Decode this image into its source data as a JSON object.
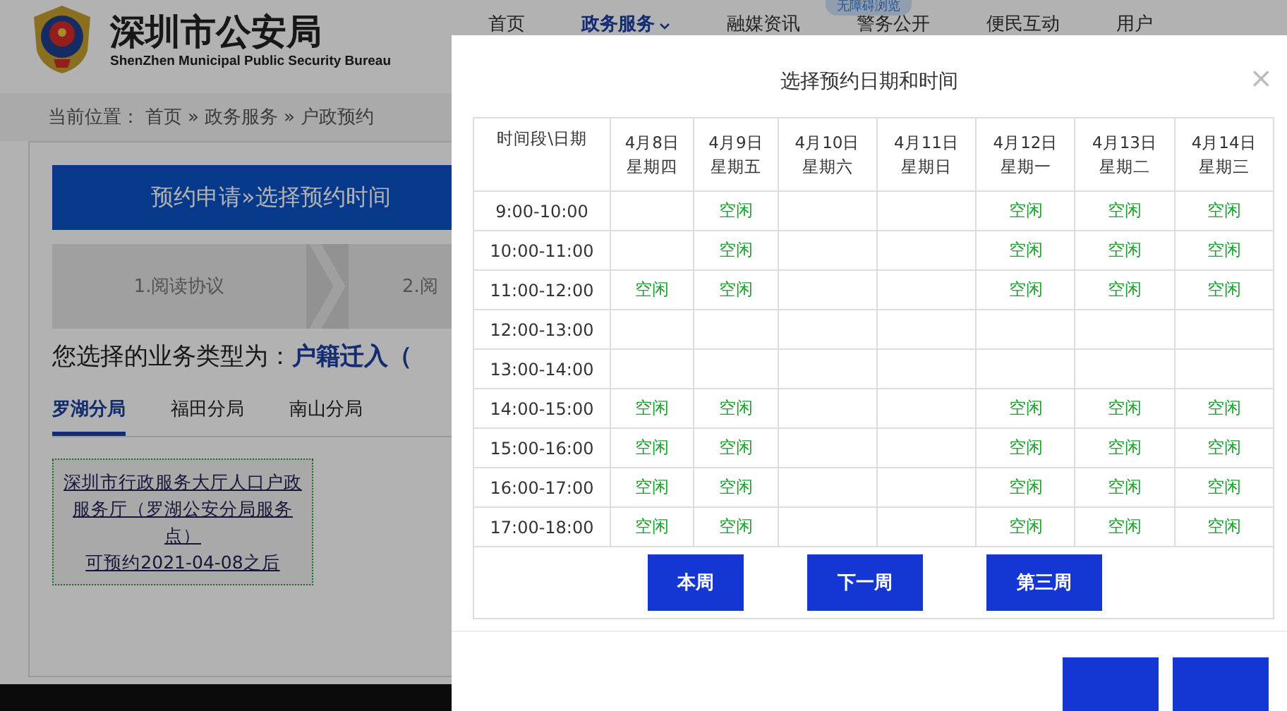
{
  "header": {
    "title": "深圳市公安局",
    "subtitle": "ShenZhen Municipal Public Security Bureau",
    "accessibility_badge": "无障碍浏览"
  },
  "nav": [
    {
      "label": "首页",
      "selected": false,
      "dropdown": false
    },
    {
      "label": "政务服务",
      "selected": true,
      "dropdown": true
    },
    {
      "label": "融媒资讯",
      "selected": false,
      "dropdown": false
    },
    {
      "label": "警务公开",
      "selected": false,
      "dropdown": false
    },
    {
      "label": "便民互动",
      "selected": false,
      "dropdown": false
    },
    {
      "label": "用户",
      "selected": false,
      "dropdown": false
    }
  ],
  "breadcrumb": {
    "label": "当前位置：",
    "separator": "»",
    "items": [
      "首页",
      "政务服务",
      "户政预约"
    ]
  },
  "banner": "预约申请»选择预约时间",
  "steps": [
    "1.阅读协议",
    "2.阅"
  ],
  "business": {
    "label": "您选择的业务类型为：",
    "value": "户籍迁入（"
  },
  "branch_tabs": [
    {
      "label": "罗湖分局",
      "selected": true
    },
    {
      "label": "福田分局",
      "selected": false
    },
    {
      "label": "南山分局",
      "selected": false
    }
  ],
  "service_points": [
    {
      "name": "深圳市行政服务大厅人口户政服务厅（罗湖公安分局服务点）",
      "availability": "可预约2021-04-08之后"
    }
  ],
  "modal": {
    "title": "选择预约日期和时间",
    "close": "×",
    "table": {
      "corner": "时间段\\日期",
      "columns": [
        {
          "date": "4月8日",
          "weekday": "星期四"
        },
        {
          "date": "4月9日",
          "weekday": "星期五"
        },
        {
          "date": "4月10日",
          "weekday": "星期六"
        },
        {
          "date": "4月11日",
          "weekday": "星期日"
        },
        {
          "date": "4月12日",
          "weekday": "星期一"
        },
        {
          "date": "4月13日",
          "weekday": "星期二"
        },
        {
          "date": "4月14日",
          "weekday": "星期三"
        }
      ],
      "rows": [
        {
          "time": "9:00-10:00",
          "cells": [
            null,
            "空闲",
            null,
            null,
            "空闲",
            "空闲",
            "空闲"
          ]
        },
        {
          "time": "10:00-11:00",
          "cells": [
            null,
            "空闲",
            null,
            null,
            "空闲",
            "空闲",
            "空闲"
          ]
        },
        {
          "time": "11:00-12:00",
          "cells": [
            "空闲",
            "空闲",
            null,
            null,
            "空闲",
            "空闲",
            "空闲"
          ]
        },
        {
          "time": "12:00-13:00",
          "cells": [
            null,
            null,
            null,
            null,
            null,
            null,
            null
          ]
        },
        {
          "time": "13:00-14:00",
          "cells": [
            null,
            null,
            null,
            null,
            null,
            null,
            null
          ]
        },
        {
          "time": "14:00-15:00",
          "cells": [
            "空闲",
            "空闲",
            null,
            null,
            "空闲",
            "空闲",
            "空闲"
          ]
        },
        {
          "time": "15:00-16:00",
          "cells": [
            "空闲",
            "空闲",
            null,
            null,
            "空闲",
            "空闲",
            "空闲"
          ]
        },
        {
          "time": "16:00-17:00",
          "cells": [
            "空闲",
            "空闲",
            null,
            null,
            "空闲",
            "空闲",
            "空闲"
          ]
        },
        {
          "time": "17:00-18:00",
          "cells": [
            "空闲",
            "空闲",
            null,
            null,
            "空闲",
            "空闲",
            "空闲"
          ]
        }
      ]
    },
    "week_buttons": [
      "本周",
      "下一周",
      "第三周"
    ],
    "footer_buttons": [
      {
        "kind": "primary"
      },
      {
        "kind": "primary"
      }
    ]
  }
}
